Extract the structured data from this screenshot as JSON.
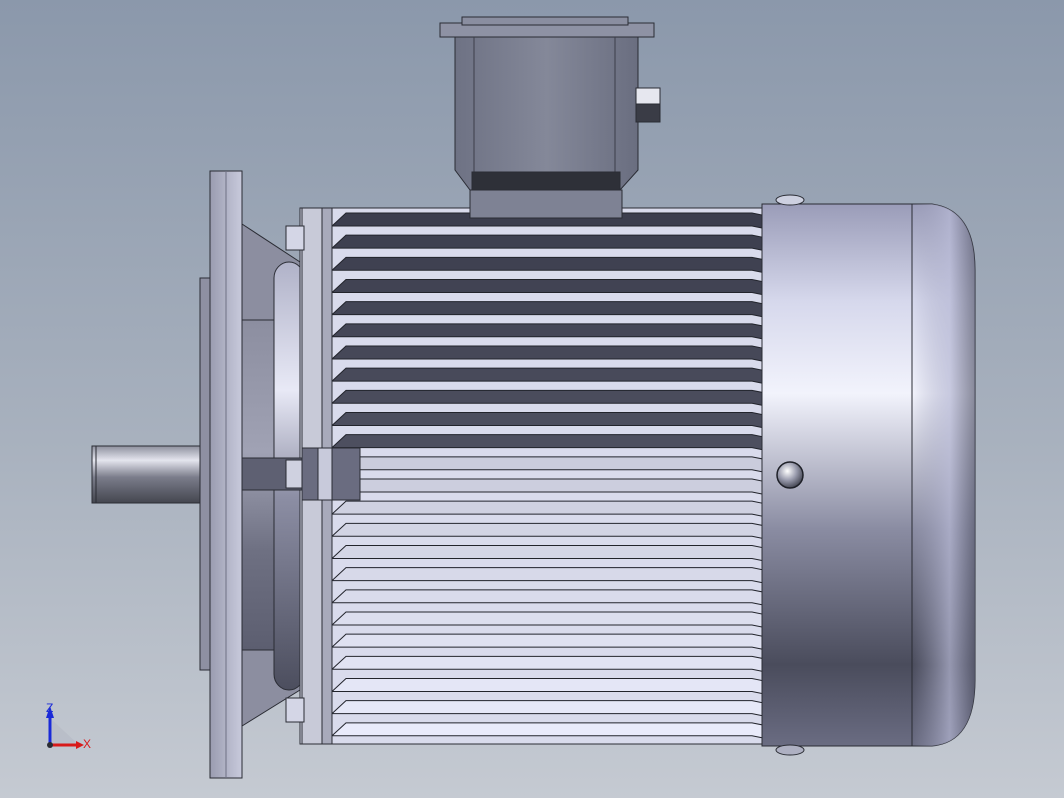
{
  "viewport": {
    "background_top": "#8b98ab",
    "background_bottom": "#c5cad2"
  },
  "triad": {
    "z_label": "Z",
    "x_label": "X",
    "z_color": "#1a2ad8",
    "x_color": "#d81a1a"
  },
  "model": {
    "icons": [
      "motor-model",
      "shaft",
      "flange",
      "terminal-box",
      "cooling-fins",
      "fan-cover",
      "fastener-bolts",
      "lifting-eye"
    ]
  }
}
